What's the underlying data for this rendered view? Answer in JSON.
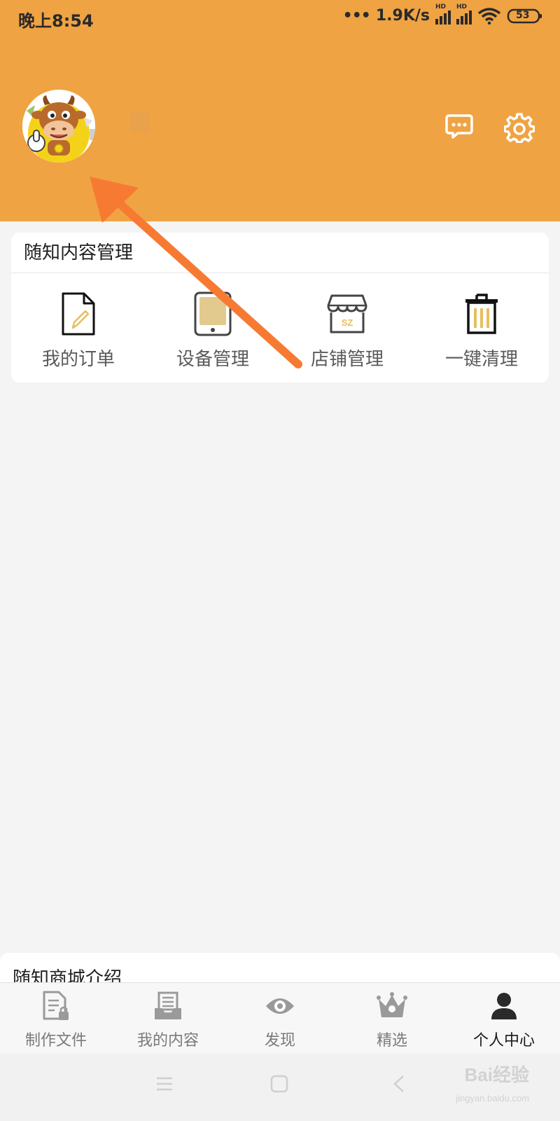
{
  "status_bar": {
    "time": "晚上8:54",
    "dots": "•••",
    "net_speed": "1.9K/s",
    "hd_label": "HD",
    "battery": "53"
  },
  "header": {
    "bg_color": "#f0a342",
    "message_icon": "chat-bubble-icon",
    "settings_icon": "gear-icon"
  },
  "content_card": {
    "title": "随知内容管理",
    "items": [
      {
        "label": "我的订单",
        "icon": "document-edit-icon"
      },
      {
        "label": "设备管理",
        "icon": "tablet-icon"
      },
      {
        "label": "店铺管理",
        "icon": "store-icon",
        "icon_text": "SZ"
      },
      {
        "label": "一键清理",
        "icon": "trash-icon"
      }
    ]
  },
  "intro_section": {
    "title": "随知商城介绍"
  },
  "tabbar": {
    "tabs": [
      {
        "label": "制作文件",
        "icon": "locked-file-icon",
        "active": false
      },
      {
        "label": "我的内容",
        "icon": "inbox-tray-icon",
        "active": false
      },
      {
        "label": "发现",
        "icon": "eye-icon",
        "active": false
      },
      {
        "label": "精选",
        "icon": "crown-icon",
        "active": false
      },
      {
        "label": "个人中心",
        "icon": "user-icon",
        "active": true
      }
    ]
  },
  "watermark": {
    "brand": "Bai经验",
    "url": "jingyan.baidu.com"
  },
  "colors": {
    "accent_orange": "#f0a342",
    "arrow_orange": "#f77a33",
    "gold": "#e6be5f"
  }
}
